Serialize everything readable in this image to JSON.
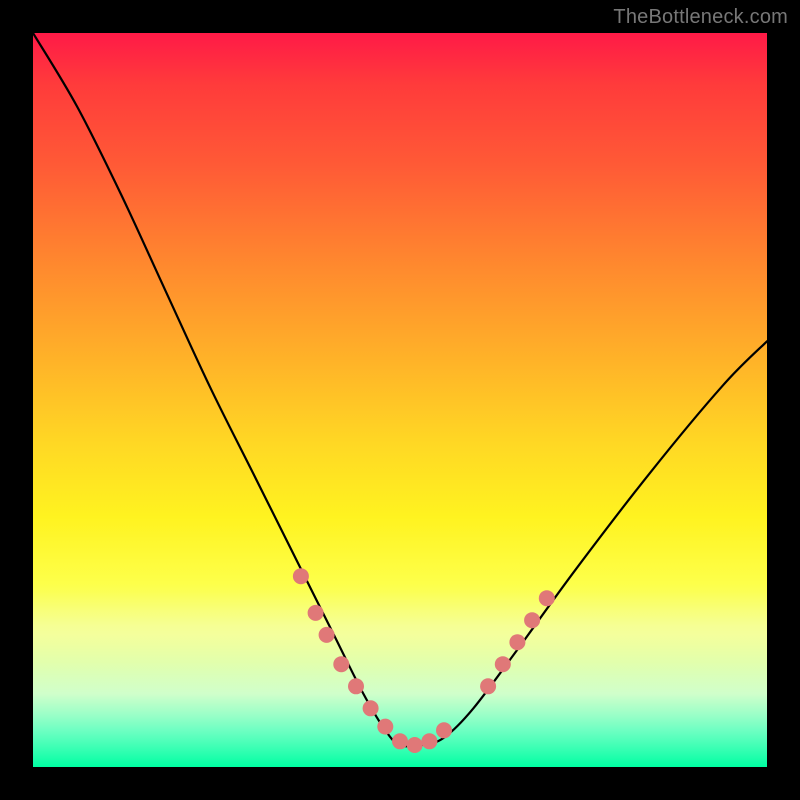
{
  "attribution": "TheBottleneck.com",
  "chart_data": {
    "type": "line",
    "title": "",
    "xlabel": "",
    "ylabel": "",
    "xlim": [
      0,
      100
    ],
    "ylim": [
      0,
      100
    ],
    "grid": false,
    "legend": false,
    "background_gradient": {
      "direction": "vertical",
      "stops": [
        {
          "pos": 0.0,
          "color": "#ff1a47"
        },
        {
          "pos": 0.18,
          "color": "#ff5a36"
        },
        {
          "pos": 0.45,
          "color": "#ffb428"
        },
        {
          "pos": 0.66,
          "color": "#fff320"
        },
        {
          "pos": 0.82,
          "color": "#f2ff8e"
        },
        {
          "pos": 0.95,
          "color": "#63ffbe"
        },
        {
          "pos": 1.0,
          "color": "#00ffa3"
        }
      ]
    },
    "series": [
      {
        "name": "bottleneck-curve",
        "color": "#000000",
        "x": [
          0,
          6,
          12,
          18,
          24,
          30,
          36,
          41,
          45,
          48,
          50,
          53,
          56,
          60,
          66,
          74,
          84,
          94,
          100
        ],
        "y": [
          100,
          90,
          78,
          65,
          52,
          40,
          28,
          18,
          10,
          5,
          3,
          3,
          4,
          8,
          16,
          27,
          40,
          52,
          58
        ]
      }
    ],
    "markers": {
      "name": "highlight-dots",
      "color": "#e07878",
      "radius": 8,
      "points": [
        {
          "x": 36.5,
          "y": 26
        },
        {
          "x": 38.5,
          "y": 21
        },
        {
          "x": 40.0,
          "y": 18
        },
        {
          "x": 42.0,
          "y": 14
        },
        {
          "x": 44.0,
          "y": 11
        },
        {
          "x": 46.0,
          "y": 8
        },
        {
          "x": 48.0,
          "y": 5.5
        },
        {
          "x": 50.0,
          "y": 3.5
        },
        {
          "x": 52.0,
          "y": 3.0
        },
        {
          "x": 54.0,
          "y": 3.5
        },
        {
          "x": 56.0,
          "y": 5.0
        },
        {
          "x": 62.0,
          "y": 11
        },
        {
          "x": 64.0,
          "y": 14
        },
        {
          "x": 66.0,
          "y": 17
        },
        {
          "x": 68.0,
          "y": 20
        },
        {
          "x": 70.0,
          "y": 23
        }
      ]
    }
  }
}
